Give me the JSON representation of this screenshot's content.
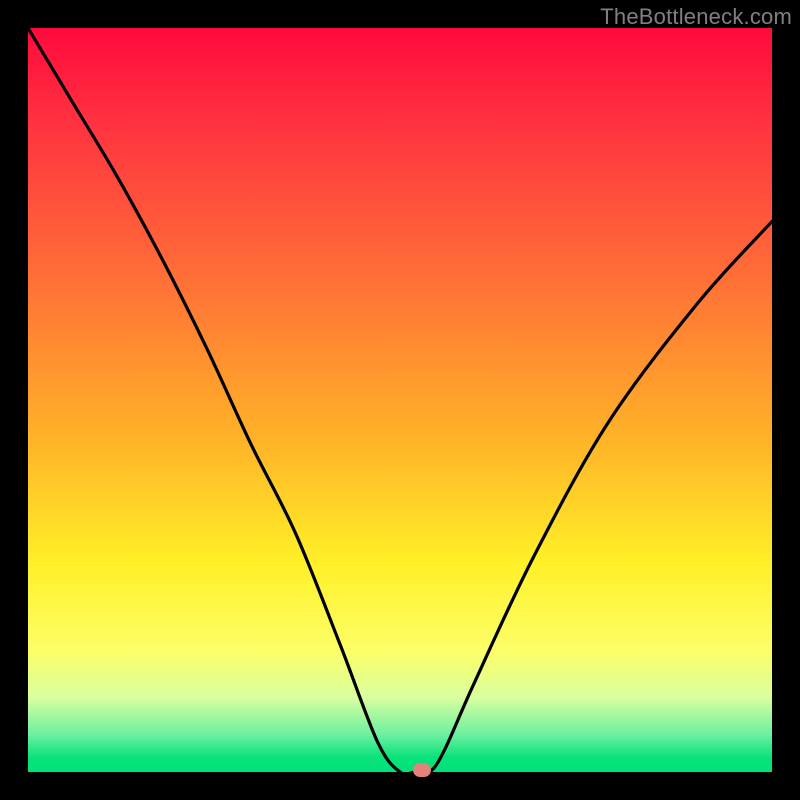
{
  "watermark": {
    "text": "TheBottleneck.com"
  },
  "chart_data": {
    "type": "line",
    "title": "",
    "xlabel": "",
    "ylabel": "",
    "xlim": [
      0,
      100
    ],
    "ylim": [
      0,
      100
    ],
    "grid": false,
    "series": [
      {
        "name": "bottleneck-curve",
        "x": [
          0,
          6,
          12,
          18,
          24,
          30,
          36,
          42,
          47,
          50,
          52,
          54,
          56,
          60,
          68,
          78,
          90,
          100
        ],
        "y": [
          100,
          90,
          80,
          69,
          57,
          44,
          32,
          17,
          4,
          0,
          0,
          0,
          3,
          12,
          29,
          47,
          63,
          74
        ]
      }
    ],
    "marker": {
      "x": 53,
      "y": 0
    },
    "background_gradient": {
      "stops": [
        {
          "pos": 0,
          "color": "#ff0a3c"
        },
        {
          "pos": 12,
          "color": "#ff3040"
        },
        {
          "pos": 32,
          "color": "#ff6a38"
        },
        {
          "pos": 55,
          "color": "#ffb228"
        },
        {
          "pos": 72,
          "color": "#fff028"
        },
        {
          "pos": 84,
          "color": "#fbff6a"
        },
        {
          "pos": 90,
          "color": "#d8ffa0"
        },
        {
          "pos": 95,
          "color": "#6cf0a0"
        },
        {
          "pos": 98,
          "color": "#0ae27a"
        },
        {
          "pos": 100,
          "color": "#00e27a"
        }
      ]
    }
  }
}
